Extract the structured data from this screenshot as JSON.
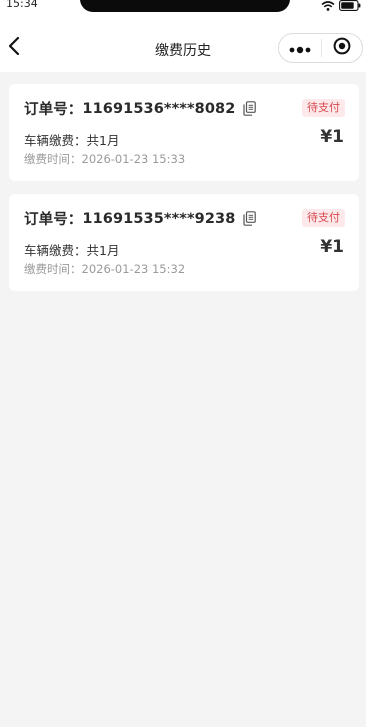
{
  "status_bar": {
    "time": "15:34",
    "icons": [
      "wifi-icon",
      "battery-icon"
    ]
  },
  "nav": {
    "title": "缴费历史",
    "back_icon": "chevron-left-icon",
    "capsule_icons": [
      "more-dots-icon",
      "close-circle-icon"
    ]
  },
  "orders": [
    {
      "order_label": "订单号：",
      "order_no": "11691536****8082",
      "status": "待支付",
      "fee_label": "车辆缴费：",
      "fee_value": "共1月",
      "price": "¥1",
      "time_label": "缴费时间：",
      "time_value": "2026-01-23 15:33"
    },
    {
      "order_label": "订单号：",
      "order_no": "11691535****9238",
      "status": "待支付",
      "fee_label": "车辆缴费：",
      "fee_value": "共1月",
      "price": "¥1",
      "time_label": "缴费时间：",
      "time_value": "2026-01-23 15:32"
    }
  ],
  "colors": {
    "page_bg": "#f4f4f5",
    "status_text": "#d9484f",
    "status_bg": "#fde9ea",
    "muted_text": "#9a9a9a"
  }
}
